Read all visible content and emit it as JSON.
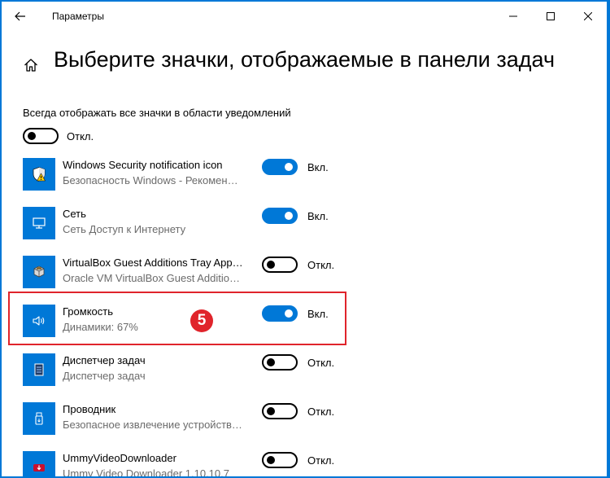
{
  "window": {
    "title": "Параметры"
  },
  "page": {
    "title": "Выберите значки, отображаемые в панели задач",
    "always_show_label": "Всегда отображать все значки в области уведомлений",
    "always_show_state": "Откл."
  },
  "apps": [
    {
      "name": "Windows Security notification icon",
      "desc": "Безопасность Windows - Рекомен…",
      "state": "Вкл.",
      "on": true,
      "icon": "shield-warning-icon"
    },
    {
      "name": "Сеть",
      "desc": "Сеть Доступ к Интернету",
      "state": "Вкл.",
      "on": true,
      "icon": "network-icon"
    },
    {
      "name": "VirtualBox Guest Additions Tray App…",
      "desc": "Oracle VM VirtualBox Guest Additio…",
      "state": "Откл.",
      "on": false,
      "icon": "virtualbox-icon"
    },
    {
      "name": "Громкость",
      "desc": "Динамики: 67%",
      "state": "Вкл.",
      "on": true,
      "icon": "speaker-icon"
    },
    {
      "name": "Диспетчер задач",
      "desc": "Диспетчер задач",
      "state": "Откл.",
      "on": false,
      "icon": "task-manager-icon"
    },
    {
      "name": "Проводник",
      "desc": "Безопасное извлечение устройств…",
      "state": "Откл.",
      "on": false,
      "icon": "usb-drive-icon"
    },
    {
      "name": "UmmyVideoDownloader",
      "desc": "Ummy Video Downloader 1.10.10.7",
      "state": "Откл.",
      "on": false,
      "icon": "download-icon"
    }
  ],
  "annotation": {
    "step_number": "5"
  },
  "colors": {
    "accent": "#0078d7",
    "highlight": "#e0242b"
  }
}
